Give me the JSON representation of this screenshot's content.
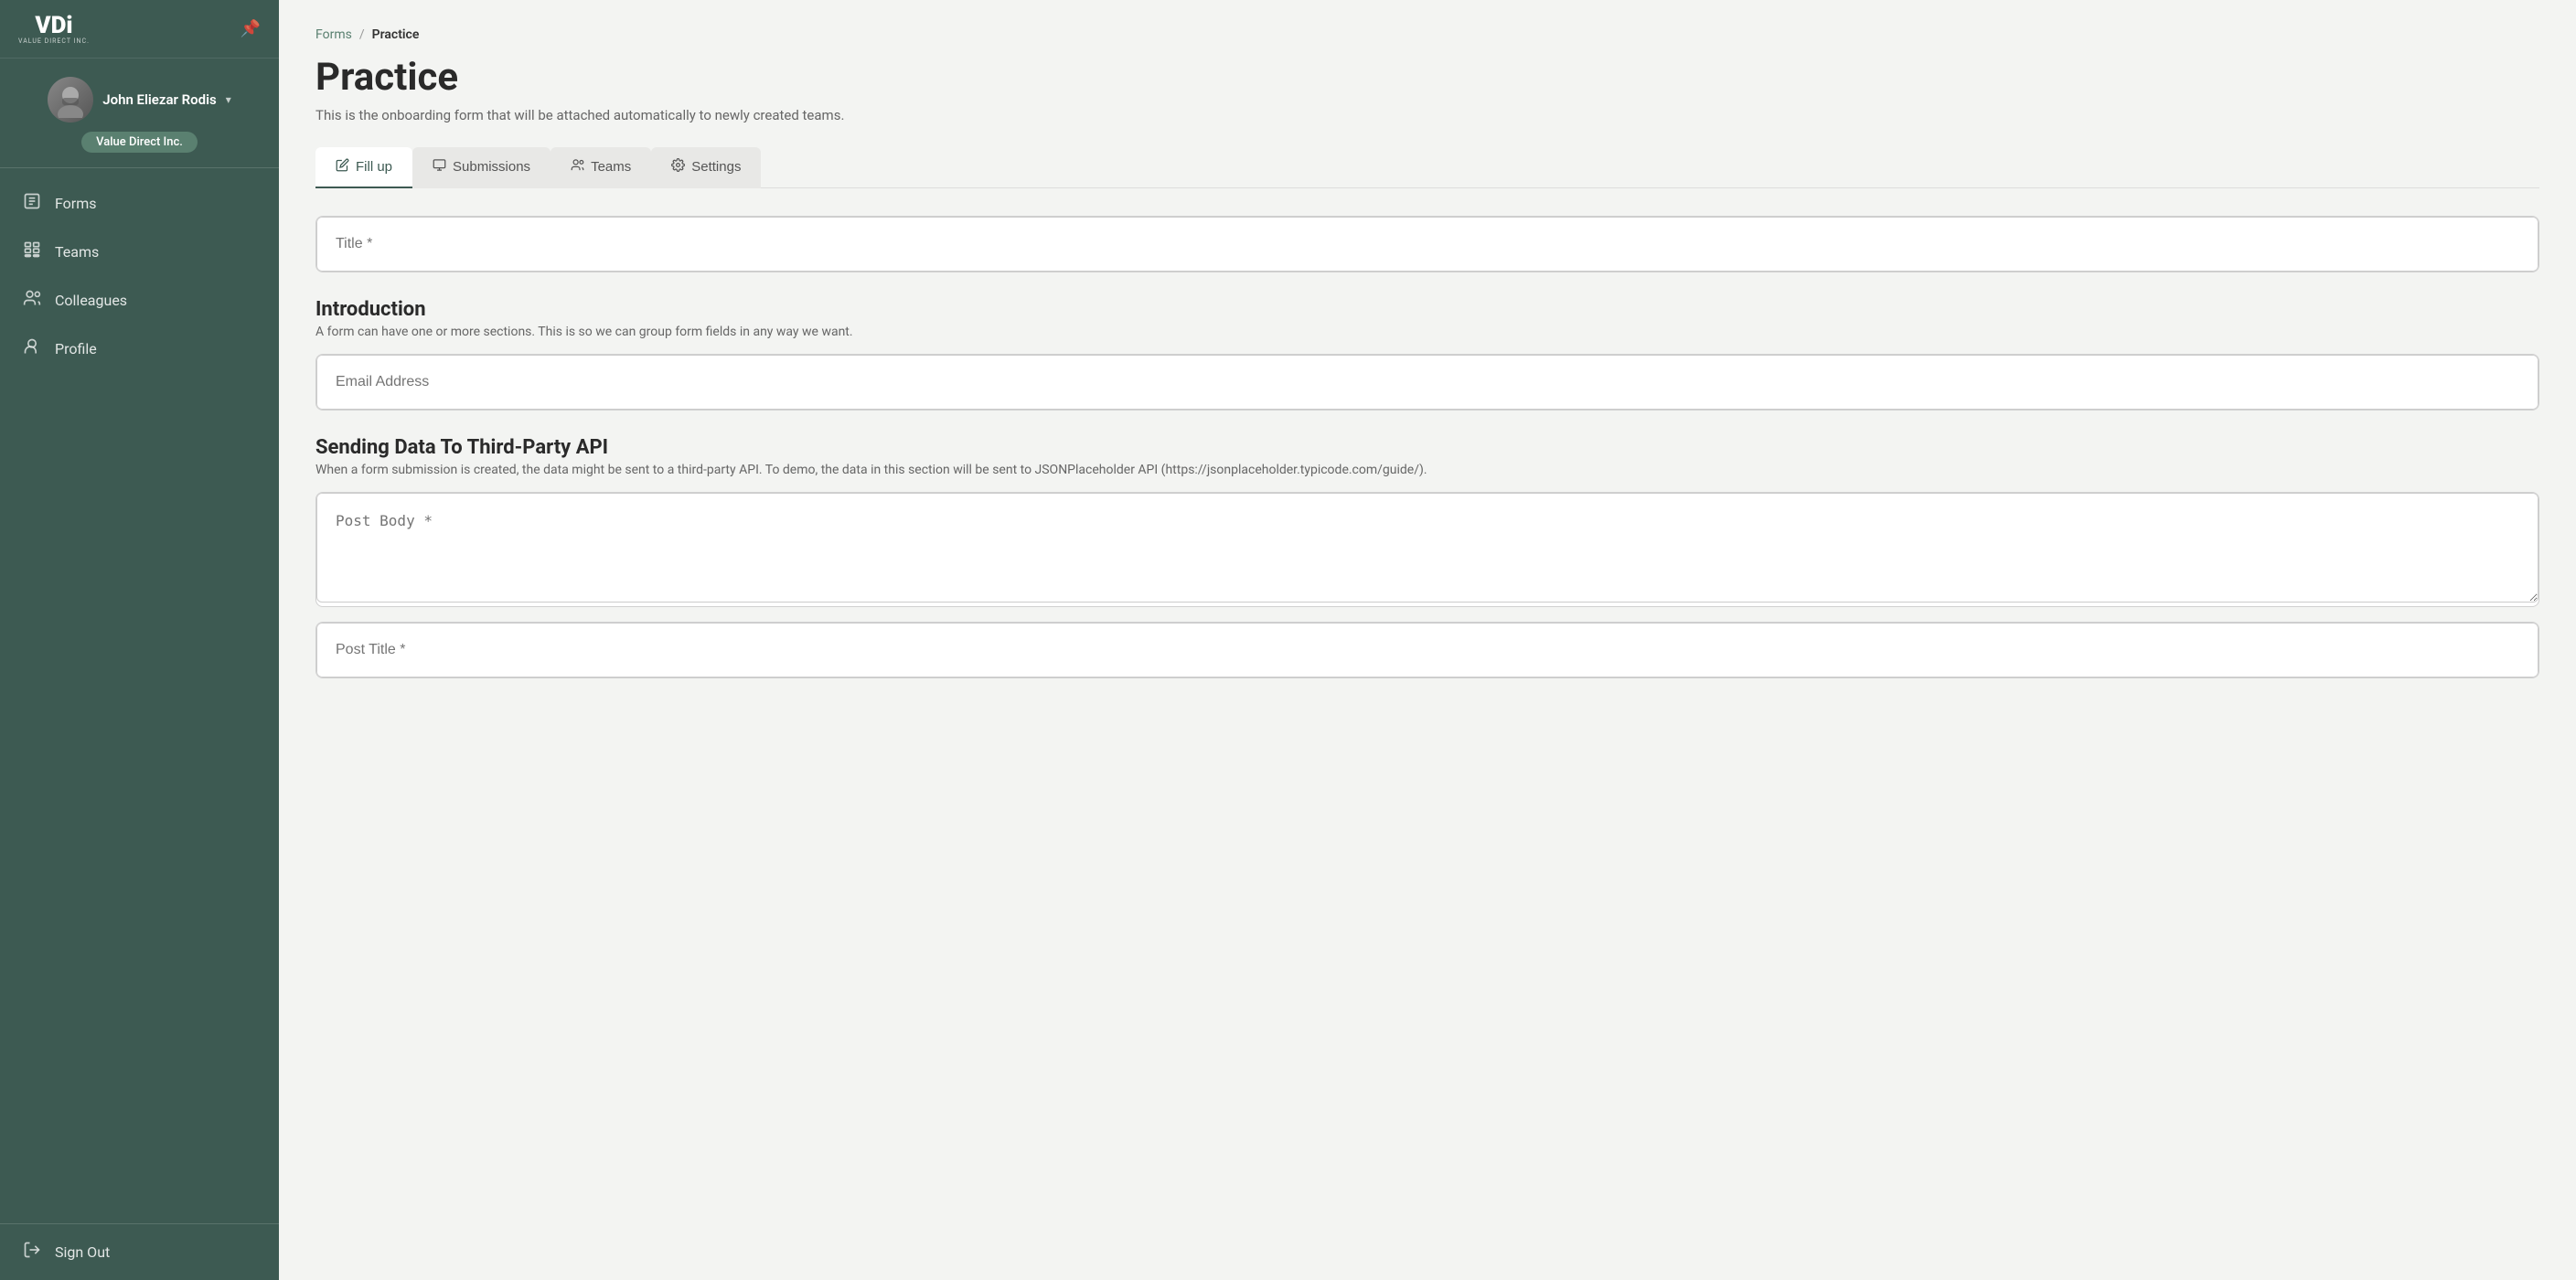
{
  "sidebar": {
    "logo": {
      "main": "VDi",
      "sub": "VALUE DIRECT INC."
    },
    "user": {
      "name": "John Eliezar Rodis",
      "company": "Value Direct Inc."
    },
    "nav_items": [
      {
        "id": "forms",
        "label": "Forms",
        "icon": "forms-icon"
      },
      {
        "id": "teams",
        "label": "Teams",
        "icon": "teams-icon"
      },
      {
        "id": "colleagues",
        "label": "Colleagues",
        "icon": "colleagues-icon"
      },
      {
        "id": "profile",
        "label": "Profile",
        "icon": "profile-icon"
      }
    ],
    "sign_out": "Sign Out"
  },
  "breadcrumb": {
    "parent": "Forms",
    "separator": "/",
    "current": "Practice"
  },
  "page": {
    "title": "Practice",
    "subtitle": "This is the onboarding form that will be attached automatically to newly created teams."
  },
  "tabs": [
    {
      "id": "fill-up",
      "label": "Fill up",
      "icon": "edit-icon",
      "active": true
    },
    {
      "id": "submissions",
      "label": "Submissions",
      "icon": "submissions-icon",
      "active": false
    },
    {
      "id": "teams",
      "label": "Teams",
      "icon": "teams-tab-icon",
      "active": false
    },
    {
      "id": "settings",
      "label": "Settings",
      "icon": "settings-icon",
      "active": false
    }
  ],
  "form": {
    "title_placeholder": "Title *",
    "sections": [
      {
        "id": "introduction",
        "title": "Introduction",
        "description": "A form can have one or more sections. This is so we can group form fields in any way we want.",
        "fields": [
          {
            "id": "email",
            "placeholder": "Email Address",
            "type": "input"
          }
        ]
      },
      {
        "id": "sending-data",
        "title": "Sending Data To Third-Party API",
        "description": "When a form submission is created, the data might be sent to a third-party API. To demo, the data in this section will be sent to JSONPlaceholder API (https://jsonplaceholder.typicode.com/guide/).",
        "fields": [
          {
            "id": "post-body",
            "placeholder": "Post Body *",
            "type": "textarea"
          },
          {
            "id": "post-title",
            "placeholder": "Post Title *",
            "type": "input"
          }
        ]
      }
    ]
  }
}
